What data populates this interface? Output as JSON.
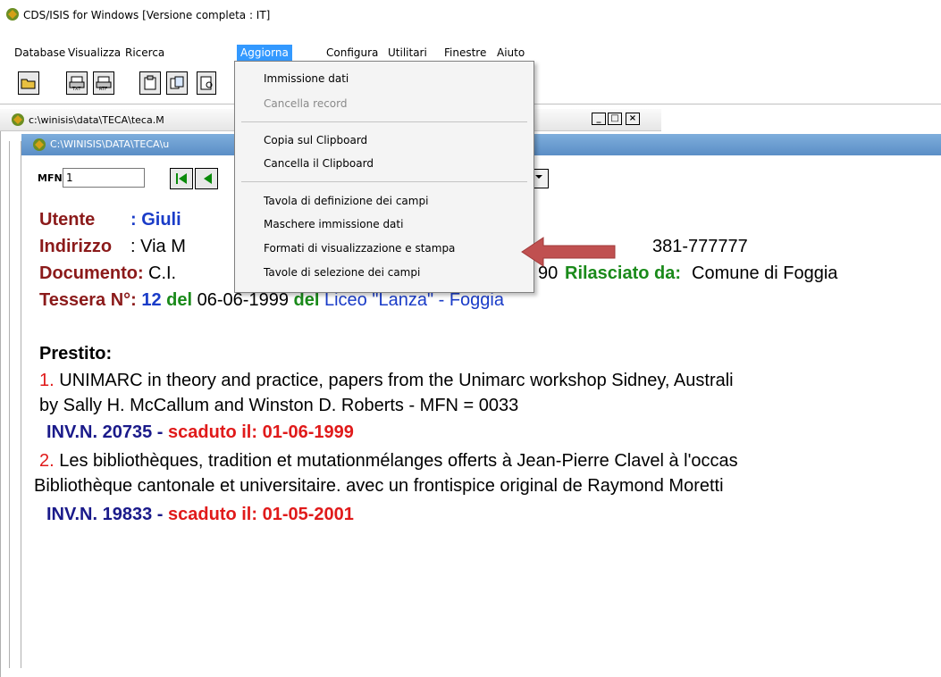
{
  "window": {
    "title": "CDS/ISIS for Windows [Versione completa : IT]"
  },
  "menubar": {
    "items": [
      "Database",
      "Visualizza",
      "Ricerca",
      "Aggiorna",
      "Configura",
      "Utilitari",
      "Finestre",
      "Aiuto"
    ],
    "active": "Aggiorna"
  },
  "aggiorna_menu": {
    "items": [
      {
        "label": "Immissione dati",
        "enabled": true
      },
      {
        "label": "Cancella record",
        "enabled": false
      },
      {
        "label": "Copia sul Clipboard",
        "enabled": true
      },
      {
        "label": "Cancella il Clipboard",
        "enabled": true
      },
      {
        "label": "Tavola di definizione dei campi",
        "enabled": true
      },
      {
        "label": "Maschere immissione dati",
        "enabled": true
      },
      {
        "label": "Formati di visualizzazione e stampa",
        "enabled": true
      },
      {
        "label": "Tavole di selezione dei campi",
        "enabled": true
      }
    ]
  },
  "outer_window": {
    "title": "c:\\winisis\\data\\TECA\\teca.M",
    "buttons": [
      "_",
      "□",
      "×"
    ]
  },
  "inner_window": {
    "title": "C:\\WINISIS\\DATA\\TECA\\u"
  },
  "record_bar": {
    "mfn_label": "MFN",
    "mfn_value": "1"
  },
  "record": {
    "utente_label": "Utente",
    "utente_sep": ": Giuli",
    "indirizzo_label": "Indirizzo",
    "indirizzo_value": ": Via M",
    "indirizzo_tail": "381-777777",
    "documento_label": "Documento:",
    "documento_value": "C.I.",
    "documento_mid": "90",
    "rilasciato_label": "Rilasciato da:",
    "rilasciato_value": "Comune di Foggia",
    "tessera_label": "Tessera N°:",
    "tessera_num": "12",
    "del1": "del",
    "tessera_date": "06-06-1999",
    "del2": "del",
    "tessera_school": "Liceo \"Lanza\" - Foggia",
    "prestito_label": "Prestito:",
    "item1_num": "1.",
    "item1_title": "UNIMARC in theory and practice, papers from the Unimarc workshop Sidney, Australi",
    "item1_line2": "by Sally H. McCallum and Winston D. Roberts - MFN = 0033",
    "item1_inv": "INV.N. 20735 -",
    "item1_due": "scaduto il: 01-06-1999",
    "item2_num": "2.",
    "item2_title": "Les bibliothèques, tradition et mutationmélanges offerts à Jean-Pierre Clavel à l'occas",
    "item2_line2": "Bibliothèque cantonale et universitaire. avec un frontispice original de Raymond Moretti",
    "item2_inv": "INV.N. 19833 -",
    "item2_due": "scaduto il: 01-05-2001"
  },
  "colors": {
    "menu_highlight": "#3399ff",
    "label_maroon": "#8b1a1a",
    "value_blue": "#1a3cc8",
    "label_green": "#1a8a1a",
    "due_red": "#e01a1a",
    "arrow": "#c05050"
  },
  "icons": [
    "app-icon",
    "open-folder-icon",
    "print-txt-icon",
    "print-rtf-icon",
    "clipboard-icon",
    "copy-icon",
    "preview-icon",
    "first-record-icon",
    "prev-record-icon",
    "dropdown-arrow-icon",
    "pointer-arrow-icon"
  ]
}
